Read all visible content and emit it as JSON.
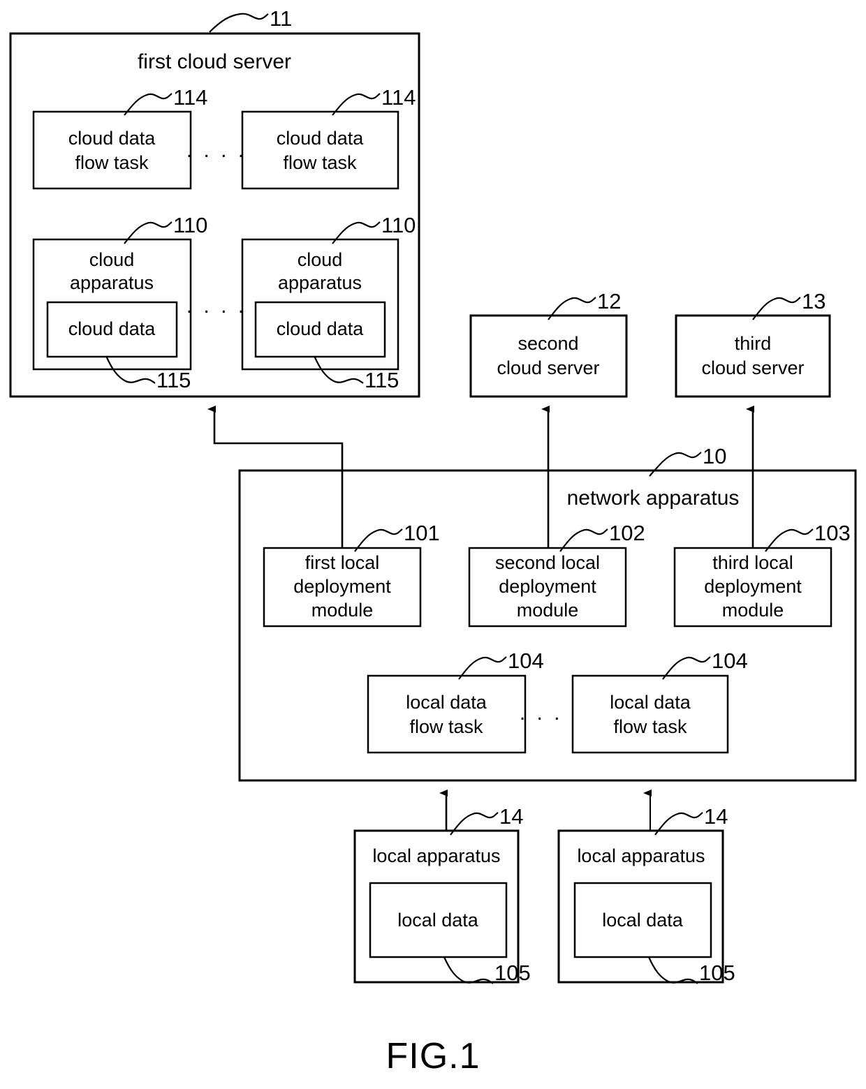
{
  "figure": {
    "caption": "FIG.1"
  },
  "blocks": {
    "first_cloud_server": {
      "label": "first cloud server",
      "ref": "11"
    },
    "cloud_data_flow_task_1": {
      "line1": "cloud data",
      "line2": "flow task",
      "ref": "114"
    },
    "cloud_data_flow_task_2": {
      "line1": "cloud data",
      "line2": "flow task",
      "ref": "114"
    },
    "cloud_apparatus_1": {
      "line1": "cloud",
      "line2": "apparatus",
      "ref": "110"
    },
    "cloud_apparatus_2": {
      "line1": "cloud",
      "line2": "apparatus",
      "ref": "110"
    },
    "cloud_data_1": {
      "label": "cloud data",
      "ref": "115"
    },
    "cloud_data_2": {
      "label": "cloud data",
      "ref": "115"
    },
    "second_cloud_server": {
      "line1": "second",
      "line2": "cloud server",
      "ref": "12"
    },
    "third_cloud_server": {
      "line1": "third",
      "line2": "cloud server",
      "ref": "13"
    },
    "network_apparatus": {
      "label": "network apparatus",
      "ref": "10"
    },
    "first_local_deployment_module": {
      "line1": "first local",
      "line2": "deployment",
      "line3": "module",
      "ref": "101"
    },
    "second_local_deployment_module": {
      "line1": "second local",
      "line2": "deployment",
      "line3": "module",
      "ref": "102"
    },
    "third_local_deployment_module": {
      "line1": "third local",
      "line2": "deployment",
      "line3": "module",
      "ref": "103"
    },
    "local_data_flow_task_1": {
      "line1": "local data",
      "line2": "flow task",
      "ref": "104"
    },
    "local_data_flow_task_2": {
      "line1": "local data",
      "line2": "flow task",
      "ref": "104"
    },
    "local_apparatus_1": {
      "label": "local apparatus",
      "ref": "14"
    },
    "local_apparatus_2": {
      "label": "local apparatus",
      "ref": "14"
    },
    "local_data_1": {
      "label": "local data",
      "ref": "105"
    },
    "local_data_2": {
      "label": "local data",
      "ref": "105"
    }
  },
  "ellipses": {
    "cloud_task_dots": ". . . .",
    "cloud_apparatus_dots": ". . . .",
    "local_task_dots": ". . . ."
  },
  "colors": {
    "stroke": "#000000",
    "fill": "#ffffff"
  }
}
